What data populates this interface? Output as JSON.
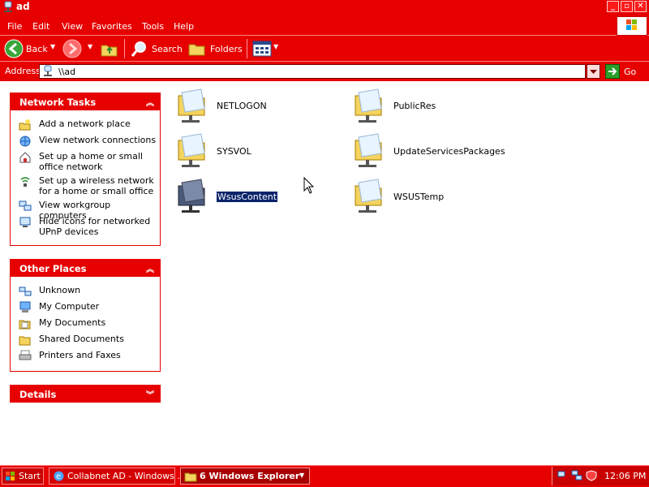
{
  "window": {
    "title": "ad"
  },
  "menu": {
    "items": [
      "File",
      "Edit",
      "View",
      "Favorites",
      "Tools",
      "Help"
    ]
  },
  "toolbar": {
    "back": "Back",
    "search": "Search",
    "folders": "Folders"
  },
  "address": {
    "label": "Address",
    "value": "\\\\ad",
    "go": "Go"
  },
  "network_tasks": {
    "title": "Network Tasks",
    "items": [
      "Add a network place",
      "View network connections",
      "Set up a home or small office network",
      "Set up a wireless network for a home or small office",
      "View workgroup computers",
      "Hide icons for networked UPnP devices"
    ]
  },
  "other_places": {
    "title": "Other Places",
    "items": [
      "Unknown",
      "My Computer",
      "My Documents",
      "Shared Documents",
      "Printers and Faxes"
    ]
  },
  "details": {
    "title": "Details"
  },
  "shares": [
    "NETLOGON",
    "PublicRes",
    "SYSVOL",
    "UpdateServicesPackages",
    "WsusContent",
    "WSUSTemp"
  ],
  "taskbar": {
    "start": "Start",
    "buttons": [
      "Collabnet AD - Windows ...",
      "6 Windows Explorer"
    ],
    "clock": "12:06 PM"
  },
  "colors": {
    "chrome": "#e60000",
    "selection": "#0a246a"
  }
}
